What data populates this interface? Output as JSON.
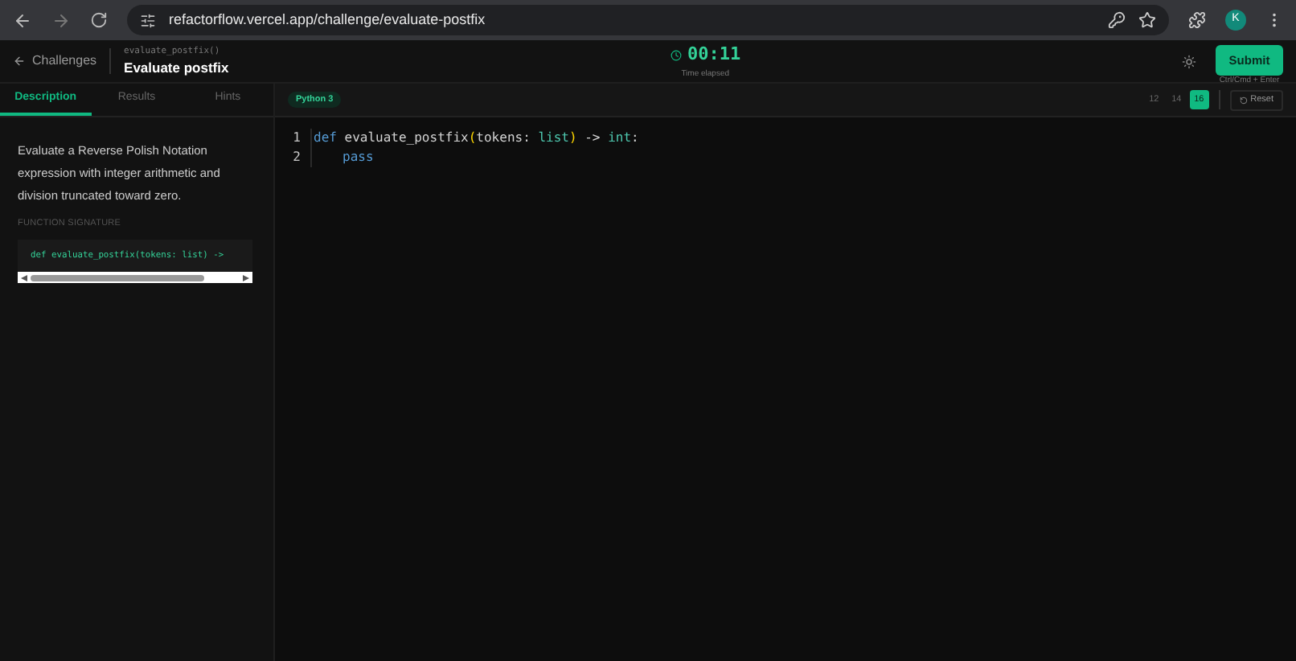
{
  "browser": {
    "url": "refactorflow.vercel.app/challenge/evaluate-postfix",
    "profile_initial": "K"
  },
  "header": {
    "back_label": "Challenges",
    "function_name": "evaluate_postfix()",
    "title": "Evaluate postfix",
    "timer": "00:11",
    "timer_label": "Time elapsed",
    "submit_label": "Submit",
    "submit_hint": "Ctrl/Cmd + Enter"
  },
  "tabs": [
    {
      "label": "Description",
      "selected": true
    },
    {
      "label": "Results",
      "selected": false
    },
    {
      "label": "Hints",
      "selected": false
    }
  ],
  "description": "Evaluate a Reverse Polish Notation expression with integer arithmetic and division truncated toward zero.",
  "signature": {
    "heading": "FUNCTION SIGNATURE",
    "code": "def evaluate_postfix(tokens: list) ->"
  },
  "editor": {
    "language": "Python 3",
    "font_sizes": [
      {
        "label": "12",
        "selected": false
      },
      {
        "label": "14",
        "selected": false
      },
      {
        "label": "16",
        "selected": true
      }
    ],
    "reset_label": "Reset",
    "lines": [
      {
        "number": "1",
        "indented": false,
        "tokens": [
          {
            "kind": "keyword",
            "text": "def"
          },
          {
            "kind": "plain",
            "text": " evaluate_postfix"
          },
          {
            "kind": "bracket",
            "text": "("
          },
          {
            "kind": "plain",
            "text": "tokens: "
          },
          {
            "kind": "type",
            "text": "list"
          },
          {
            "kind": "bracket",
            "text": ")"
          },
          {
            "kind": "plain",
            "text": " -> "
          },
          {
            "kind": "type",
            "text": "int"
          },
          {
            "kind": "plain",
            "text": ":"
          }
        ]
      },
      {
        "number": "2",
        "indented": true,
        "tokens": [
          {
            "kind": "keyword",
            "text": "pass"
          }
        ]
      }
    ]
  }
}
